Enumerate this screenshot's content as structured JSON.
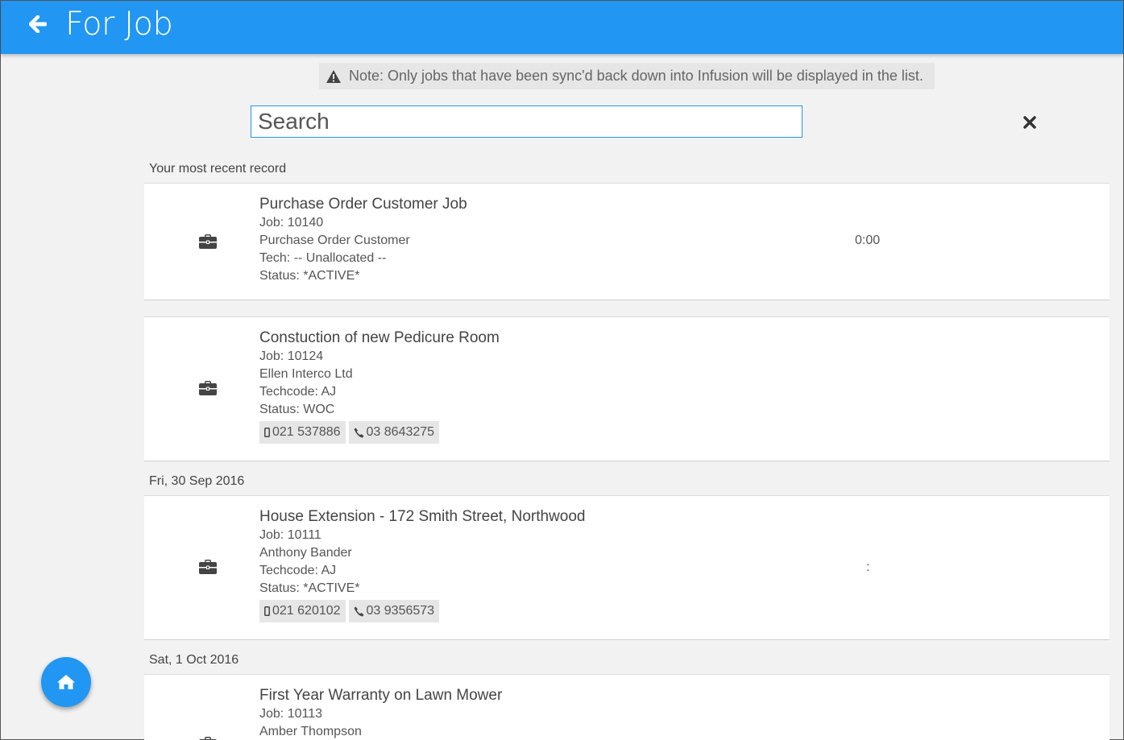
{
  "header": {
    "title": "For Job",
    "back_icon": "arrow-left-icon"
  },
  "note": {
    "icon": "warning-icon",
    "text": "Note: Only jobs that have been sync'd back down into Infusion will be displayed in the list."
  },
  "search": {
    "placeholder": "Search",
    "value": "",
    "clear_icon": "close-icon"
  },
  "sections": [
    {
      "label": "Your most recent record",
      "jobs": [
        {
          "title": "Purchase Order Customer Job",
          "job": "Job: 10140",
          "customer": "Purchase Order Customer",
          "tech": "Tech: -- Unallocated --",
          "status": "Status: *ACTIVE*",
          "time": "0:00",
          "phones": []
        }
      ]
    },
    {
      "label": "",
      "jobs": [
        {
          "title": "Constuction of new Pedicure Room",
          "job": "Job: 10124",
          "customer": "Ellen Interco Ltd",
          "tech": "Techcode: AJ",
          "status": "Status: WOC",
          "time": "",
          "phones": [
            {
              "icon": "mobile-icon",
              "number": "021 537886"
            },
            {
              "icon": "phone-icon",
              "number": "03 8643275"
            }
          ]
        }
      ]
    },
    {
      "label": "Fri, 30 Sep 2016",
      "jobs": [
        {
          "title": "House Extension - 172 Smith Street, Northwood",
          "job": "Job: 10111",
          "customer": "Anthony Bander",
          "tech": "Techcode: AJ",
          "status": "Status: *ACTIVE*",
          "time": ":",
          "phones": [
            {
              "icon": "mobile-icon",
              "number": "021 620102"
            },
            {
              "icon": "phone-icon",
              "number": "03 9356573"
            }
          ]
        }
      ]
    },
    {
      "label": "Sat, 1 Oct 2016",
      "jobs": [
        {
          "title": "First Year Warranty on Lawn Mower",
          "job": "Job: 10113",
          "customer": "Amber Thompson",
          "tech": "",
          "status": "",
          "time": "",
          "phones": []
        }
      ]
    }
  ],
  "fab": {
    "icon": "home-icon"
  },
  "colors": {
    "primary": "#2196f3",
    "background": "#f2f2f2",
    "note_bg": "#e6e6e6"
  }
}
